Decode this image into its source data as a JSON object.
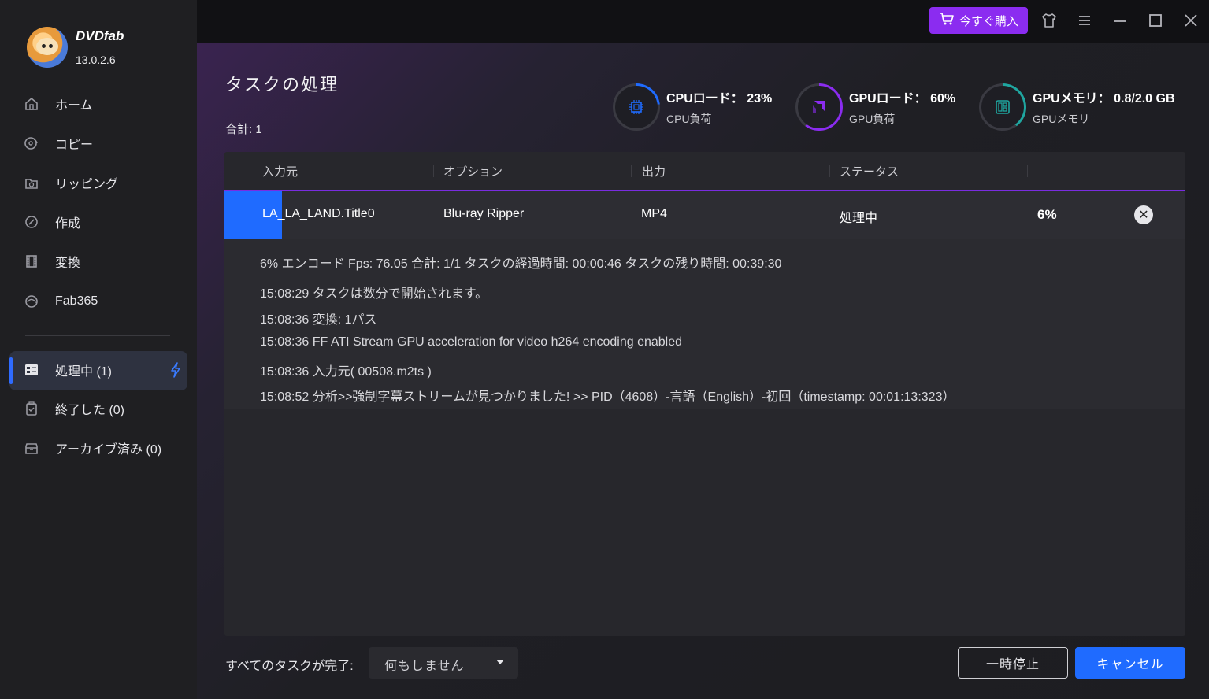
{
  "app": {
    "brand": "DVDfab",
    "version": "13.0.2.6"
  },
  "titlebar": {
    "buy_label": "今すぐ購入"
  },
  "sidebar": {
    "items": [
      {
        "label": "ホーム",
        "icon": "home-icon"
      },
      {
        "label": "コピー",
        "icon": "copy-disc-icon"
      },
      {
        "label": "リッピング",
        "icon": "ripping-icon"
      },
      {
        "label": "作成",
        "icon": "create-disc-icon"
      },
      {
        "label": "変換",
        "icon": "film-icon"
      },
      {
        "label": "Fab365",
        "icon": "cloud-icon"
      }
    ],
    "queue": [
      {
        "label": "処理中 (1)",
        "icon": "list-icon",
        "active": true
      },
      {
        "label": "終了した (0)",
        "icon": "clipboard-check-icon"
      },
      {
        "label": "アーカイブ済み (0)",
        "icon": "archive-icon"
      }
    ]
  },
  "main": {
    "title": "タスクの処理",
    "total": "合計: 1"
  },
  "meters": {
    "cpu": {
      "label": "CPUロード：",
      "value": "23%",
      "sub": "CPU負荷",
      "fraction": 0.23,
      "color": "#1f6bff"
    },
    "gpu": {
      "label": "GPUロード：",
      "value": "60%",
      "sub": "GPU負荷",
      "fraction": 0.6,
      "color": "#8b2cf0"
    },
    "mem": {
      "label": "GPUメモリ：",
      "value": "0.8/2.0 GB",
      "sub": "GPUメモリ",
      "fraction": 0.4,
      "color": "#1fa6a0"
    }
  },
  "table": {
    "headers": [
      "入力元",
      "オプション",
      "出力",
      "ステータス"
    ],
    "row": {
      "source": "LA_LA_LAND.Title0",
      "option": "Blu-ray Ripper",
      "output": "MP4",
      "status": "処理中",
      "percent": "6%",
      "progress": 0.06
    },
    "log": [
      "6%  エンコード Fps: 76.05   合計: 1/1  タスクの経過時間: 00:00:46  タスクの残り時間: 00:39:30",
      "15:08:29  タスクは数分で開始されます。",
      "15:08:36  変換: 1パス",
      "15:08:36  FF ATI Stream GPU acceleration for video h264 encoding enabled",
      "15:08:36  入力元( 00508.m2ts )",
      "15:08:52  分析>>強制字幕ストリームが見つかりました!  >> PID（4608）-言語（English）-初回（timestamp: 00:01:13:323）"
    ]
  },
  "footer": {
    "after_label": "すべてのタスクが完了:",
    "after_value": "何もしません",
    "pause_label": "一時停止",
    "cancel_label": "キャンセル"
  }
}
